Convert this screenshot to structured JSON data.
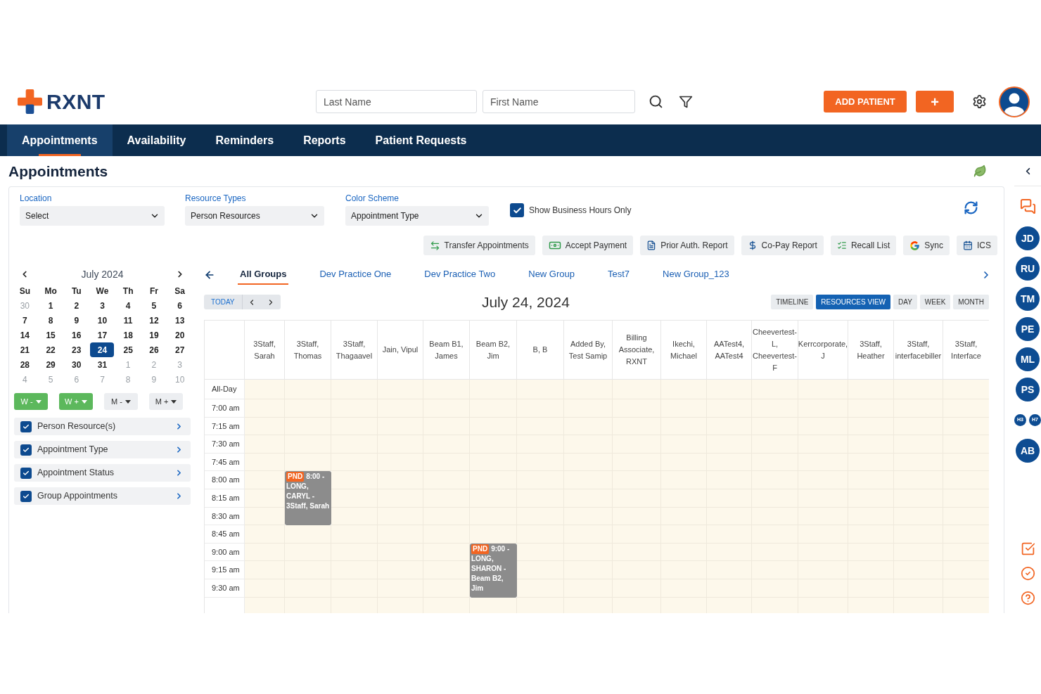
{
  "header": {
    "brand": "RXNT",
    "search_fields": [
      {
        "placeholder": "Last Name"
      },
      {
        "placeholder": "First Name"
      }
    ],
    "add_patient_button": "ADD PATIENT",
    "plus_button": "+"
  },
  "nav": [
    {
      "label": "Appointments",
      "selected": true
    },
    {
      "label": "Availability",
      "selected": false
    },
    {
      "label": "Reminders",
      "selected": false
    },
    {
      "label": "Reports",
      "selected": false
    },
    {
      "label": "Patient Requests",
      "selected": false
    }
  ],
  "page_title": "Appointments",
  "filters": [
    {
      "label": "Location",
      "value": "Select"
    },
    {
      "label": "Resource Types",
      "value": "Person Resources"
    },
    {
      "label": "Color Scheme",
      "value": "Appointment Type"
    }
  ],
  "business_hours": {
    "label": "Show Business Hours Only",
    "checked": true
  },
  "actions": [
    "Transfer Appointments",
    "Accept Payment",
    "Prior Auth. Report",
    "Co-Pay Report",
    "Recall List",
    "Sync",
    "ICS"
  ],
  "mini_calendar": {
    "title": "July 2024",
    "weekdays": [
      "Su",
      "Mo",
      "Tu",
      "We",
      "Th",
      "Fr",
      "Sa"
    ],
    "weeks": [
      [
        {
          "label": "30",
          "in_month": false,
          "selected": false
        },
        {
          "label": "1",
          "in_month": true,
          "selected": false
        },
        {
          "label": "2",
          "in_month": true,
          "selected": false
        },
        {
          "label": "3",
          "in_month": true,
          "selected": false
        },
        {
          "label": "4",
          "in_month": true,
          "selected": false
        },
        {
          "label": "5",
          "in_month": true,
          "selected": false
        },
        {
          "label": "6",
          "in_month": true,
          "selected": false
        }
      ],
      [
        {
          "label": "7",
          "in_month": true,
          "selected": false
        },
        {
          "label": "8",
          "in_month": true,
          "selected": false
        },
        {
          "label": "9",
          "in_month": true,
          "selected": false
        },
        {
          "label": "10",
          "in_month": true,
          "selected": false
        },
        {
          "label": "11",
          "in_month": true,
          "selected": false
        },
        {
          "label": "12",
          "in_month": true,
          "selected": false
        },
        {
          "label": "13",
          "in_month": true,
          "selected": false
        }
      ],
      [
        {
          "label": "14",
          "in_month": true,
          "selected": false
        },
        {
          "label": "15",
          "in_month": true,
          "selected": false
        },
        {
          "label": "16",
          "in_month": true,
          "selected": false
        },
        {
          "label": "17",
          "in_month": true,
          "selected": false
        },
        {
          "label": "18",
          "in_month": true,
          "selected": false
        },
        {
          "label": "19",
          "in_month": true,
          "selected": false
        },
        {
          "label": "20",
          "in_month": true,
          "selected": false
        }
      ],
      [
        {
          "label": "21",
          "in_month": true,
          "selected": false
        },
        {
          "label": "22",
          "in_month": true,
          "selected": false
        },
        {
          "label": "23",
          "in_month": true,
          "selected": false
        },
        {
          "label": "24",
          "in_month": true,
          "selected": true
        },
        {
          "label": "25",
          "in_month": true,
          "selected": false
        },
        {
          "label": "26",
          "in_month": true,
          "selected": false
        },
        {
          "label": "27",
          "in_month": true,
          "selected": false
        }
      ],
      [
        {
          "label": "28",
          "in_month": true,
          "selected": false
        },
        {
          "label": "29",
          "in_month": true,
          "selected": false
        },
        {
          "label": "30",
          "in_month": true,
          "selected": false
        },
        {
          "label": "31",
          "in_month": true,
          "selected": false
        },
        {
          "label": "1",
          "in_month": false,
          "selected": false
        },
        {
          "label": "2",
          "in_month": false,
          "selected": false
        },
        {
          "label": "3",
          "in_month": false,
          "selected": false
        }
      ],
      [
        {
          "label": "4",
          "in_month": false,
          "selected": false
        },
        {
          "label": "5",
          "in_month": false,
          "selected": false
        },
        {
          "label": "6",
          "in_month": false,
          "selected": false
        },
        {
          "label": "7",
          "in_month": false,
          "selected": false
        },
        {
          "label": "8",
          "in_month": false,
          "selected": false
        },
        {
          "label": "9",
          "in_month": false,
          "selected": false
        },
        {
          "label": "10",
          "in_month": false,
          "selected": false
        }
      ]
    ]
  },
  "jump_buttons": [
    {
      "label": "W -",
      "color": "#5cb85c"
    },
    {
      "label": "W +",
      "color": "#5cb85c"
    },
    {
      "label": "M -",
      "color": "#eceef1"
    },
    {
      "label": "M +",
      "color": "#eceef1"
    }
  ],
  "filter_panels": [
    {
      "label": "Person Resource(s)",
      "checked": true
    },
    {
      "label": "Appointment Type",
      "checked": true
    },
    {
      "label": "Appointment Status",
      "checked": true
    },
    {
      "label": "Group Appointments",
      "checked": true
    }
  ],
  "group_tabs": [
    {
      "label": "All Groups",
      "selected": true
    },
    {
      "label": "Dev Practice One",
      "selected": false
    },
    {
      "label": "Dev Practice Two",
      "selected": false
    },
    {
      "label": "New Group",
      "selected": false
    },
    {
      "label": "Test7",
      "selected": false
    },
    {
      "label": "New Group_123",
      "selected": false
    }
  ],
  "date_nav": {
    "today": "TODAY",
    "title": "July 24, 2024",
    "views": [
      {
        "label": "TIMELINE",
        "selected": false
      },
      {
        "label": "RESOURCES VIEW",
        "selected": true
      },
      {
        "label": "DAY",
        "selected": false
      },
      {
        "label": "WEEK",
        "selected": false
      },
      {
        "label": "MONTH",
        "selected": false
      }
    ]
  },
  "schedule": {
    "columns": [
      "3Staff, Sarah",
      "3Staff, Thomas",
      "3Staff, Thagaavel",
      "Jain, Vipul",
      "Beam B1, James",
      "Beam B2, Jim",
      "B, B",
      "Added By, Test Samip",
      "Billing Associate, RXNT",
      "Ikechi, Michael",
      "AATest4, AATest4",
      "Cheevertest-L, Cheevertest-F",
      "Kerrcorporate, J",
      "3Staff, Heather",
      "3Staff, interfacebiller",
      "3Staff, Interface"
    ],
    "rows": [
      {
        "time": "All-Day"
      },
      {
        "time": "7:00 am"
      },
      {
        "time": "7:15 am"
      },
      {
        "time": "7:30 am"
      },
      {
        "time": "7:45 am"
      },
      {
        "time": "8:00 am",
        "cells": [
          {
            "kind": "empty"
          },
          {
            "kind": "appointment",
            "status": "PND",
            "time": "8:00 -",
            "text": "LONG, CARYL - 3Staff, Sarah"
          }
        ]
      },
      {
        "time": "8:15 am"
      },
      {
        "time": "8:30 am"
      },
      {
        "time": "8:45 am"
      },
      {
        "time": "9:00 am",
        "cells": [
          {
            "kind": "empty"
          },
          {
            "kind": "empty"
          },
          {
            "kind": "empty"
          },
          {
            "kind": "empty"
          },
          {
            "kind": "empty"
          },
          {
            "kind": "appointment",
            "status": "PND",
            "time": "9:00 -",
            "text": "LONG, SHARON - Beam B2, Jim"
          }
        ]
      },
      {
        "time": "9:15 am"
      },
      {
        "time": "9:30 am"
      }
    ]
  },
  "sidebar": {
    "users": [
      {
        "kind": "avatar",
        "initials": "JD"
      },
      {
        "kind": "avatar",
        "initials": "RU"
      },
      {
        "kind": "avatar",
        "initials": "TM"
      },
      {
        "kind": "avatar",
        "initials": "PE"
      },
      {
        "kind": "avatar",
        "initials": "ML"
      },
      {
        "kind": "avatar",
        "initials": "PS"
      },
      {
        "kind": "avatar_pair",
        "initials": [
          "H3",
          "H7"
        ]
      },
      {
        "kind": "avatar",
        "initials": "AB"
      }
    ]
  }
}
